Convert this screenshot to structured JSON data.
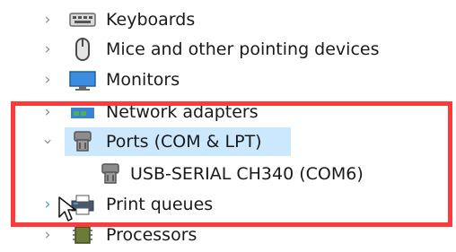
{
  "device_tree": {
    "items": [
      {
        "label": "Keyboards",
        "icon": "keyboard-icon",
        "state": "collapsed"
      },
      {
        "label": "Mice and other pointing devices",
        "icon": "mouse-icon",
        "state": "collapsed"
      },
      {
        "label": "Monitors",
        "icon": "monitor-icon",
        "state": "collapsed"
      },
      {
        "label": "Network adapters",
        "icon": "network-adapter-icon",
        "state": "collapsed"
      },
      {
        "label": "Ports (COM & LPT)",
        "icon": "port-icon",
        "state": "expanded",
        "selected": true,
        "children": [
          {
            "label": "USB-SERIAL CH340 (COM6)",
            "icon": "serial-port-icon"
          }
        ]
      },
      {
        "label": "Print queues",
        "icon": "printer-icon",
        "state": "collapsed"
      },
      {
        "label": "Processors",
        "icon": "processor-icon",
        "state": "collapsed"
      }
    ]
  },
  "colors": {
    "selection_bg": "#cce8ff",
    "highlight_border": "#ff3a3a",
    "chevron": "#8a8a8a"
  }
}
